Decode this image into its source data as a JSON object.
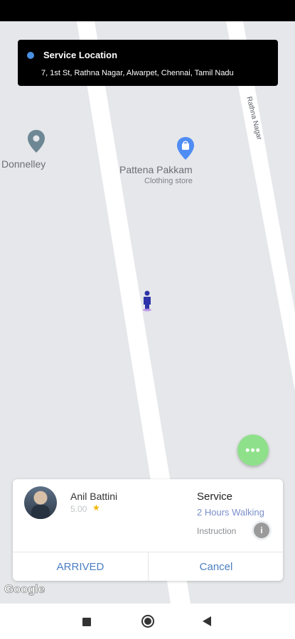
{
  "service_location": {
    "title": "Service Location",
    "address": "7, 1st St, Rathna Nagar, Alwarpet, Chennai, Tamil Nadu"
  },
  "map": {
    "pois": [
      {
        "name": "Donnelley",
        "icon": "map-pin-icon"
      },
      {
        "name": "Pattena Pakkam",
        "subtitle": "Clothing store",
        "icon": "shopping-bag-pin-icon"
      }
    ],
    "road_label": "Rathna Nagar",
    "attribution": "Google",
    "fab_icon": "more-horizontal-icon",
    "fab_color": "#8fe08a"
  },
  "trip": {
    "driver_name": "Anil Battini",
    "rating": "5.00",
    "service_title": "Service",
    "service_type": "2 Hours Walking",
    "instruction_label": "Instruction",
    "arrived_label": "ARRIVED",
    "cancel_label": "Cancel",
    "accent_color": "#4a7fc1"
  },
  "nav": {
    "recents_icon": "square-icon",
    "home_icon": "circle-icon",
    "back_icon": "triangle-back-icon"
  }
}
